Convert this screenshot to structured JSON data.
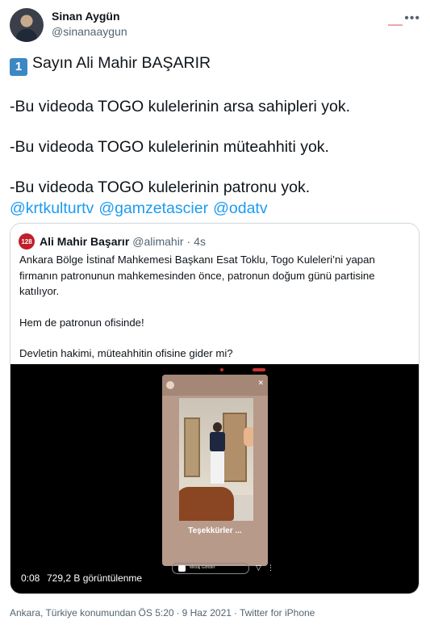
{
  "author": {
    "name": "Sinan Aygün",
    "handle": "@sinanaaygun"
  },
  "header_icons": {
    "more": "more-icon"
  },
  "tweet": {
    "keycap": "1",
    "lines": [
      "Sayın Ali Mahir BAŞARIR",
      "-Bu videoda TOGO kulelerinin arsa sahipleri yok.",
      "-Bu videoda TOGO kulelerinin müteahhiti yok.",
      "-Bu videoda TOGO kulelerinin patronu yok."
    ],
    "mentions": [
      "@krtkulturtv",
      "@gamzetascier",
      "@odatv"
    ]
  },
  "quoted": {
    "avatar_text": "128",
    "name": "Ali Mahir Başarır",
    "handle": "@alimahir",
    "separator": "·",
    "time": "4s",
    "paragraphs": [
      "Ankara Bölge İstinaf Mahkemesi Başkanı Esat Toklu, Togo Kuleleri’ni yapan firmanın patronunun mahkemesinden önce, patronun doğum günü partisine katılıyor.",
      "Hem de patronun ofisinde!",
      "Devletin hakimi, müteahhitin ofisine gider mi?"
    ],
    "video": {
      "time": "0:08",
      "views": "729,2 B görüntülenme",
      "story_caption": "Teşekkürler ...",
      "story_message": "Mesaj Gönder"
    }
  },
  "footer": {
    "location": "Ankara, Türkiye konumundan",
    "time": "ÖS 5:20",
    "separator1": "·",
    "date": "9 Haz 2021",
    "separator2": "·",
    "source": "Twitter for iPhone"
  },
  "colors": {
    "link": "#1d9bf0",
    "secondary_text": "#536471",
    "border": "#cfd9de",
    "keycap": "#3b88c3"
  }
}
